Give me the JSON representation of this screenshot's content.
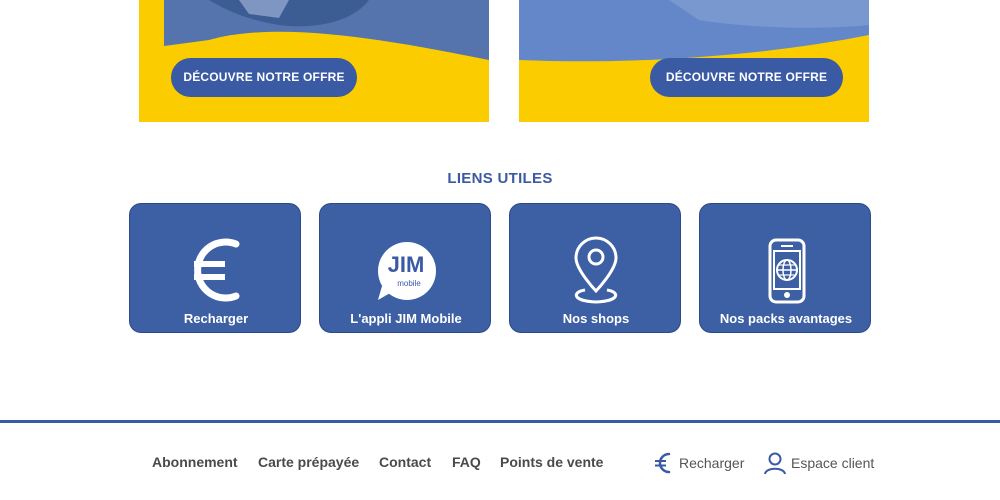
{
  "promos": [
    {
      "cta_label": "DÉCOUVRE NOTRE OFFRE"
    },
    {
      "cta_label": "DÉCOUVRE NOTRE OFFRE"
    }
  ],
  "useful_links": {
    "title": "LIENS UTILES",
    "tiles": [
      {
        "label": "Recharger",
        "icon": "euro-icon"
      },
      {
        "label": "L'appli JIM Mobile",
        "icon": "jim-app-icon",
        "logo_text": "JIM",
        "logo_subtext": "mobile"
      },
      {
        "label": "Nos shops",
        "icon": "location-pin-icon"
      },
      {
        "label": "Nos packs avantages",
        "icon": "phone-globe-icon"
      }
    ]
  },
  "footer": {
    "nav": [
      "Abonnement",
      "Carte prépayée",
      "Contact",
      "FAQ",
      "Points de vente"
    ],
    "recharge_label": "Recharger",
    "account_label": "Espace client"
  },
  "colors": {
    "brand_blue": "#3a5aa3",
    "brand_yellow": "#fbcc00"
  }
}
